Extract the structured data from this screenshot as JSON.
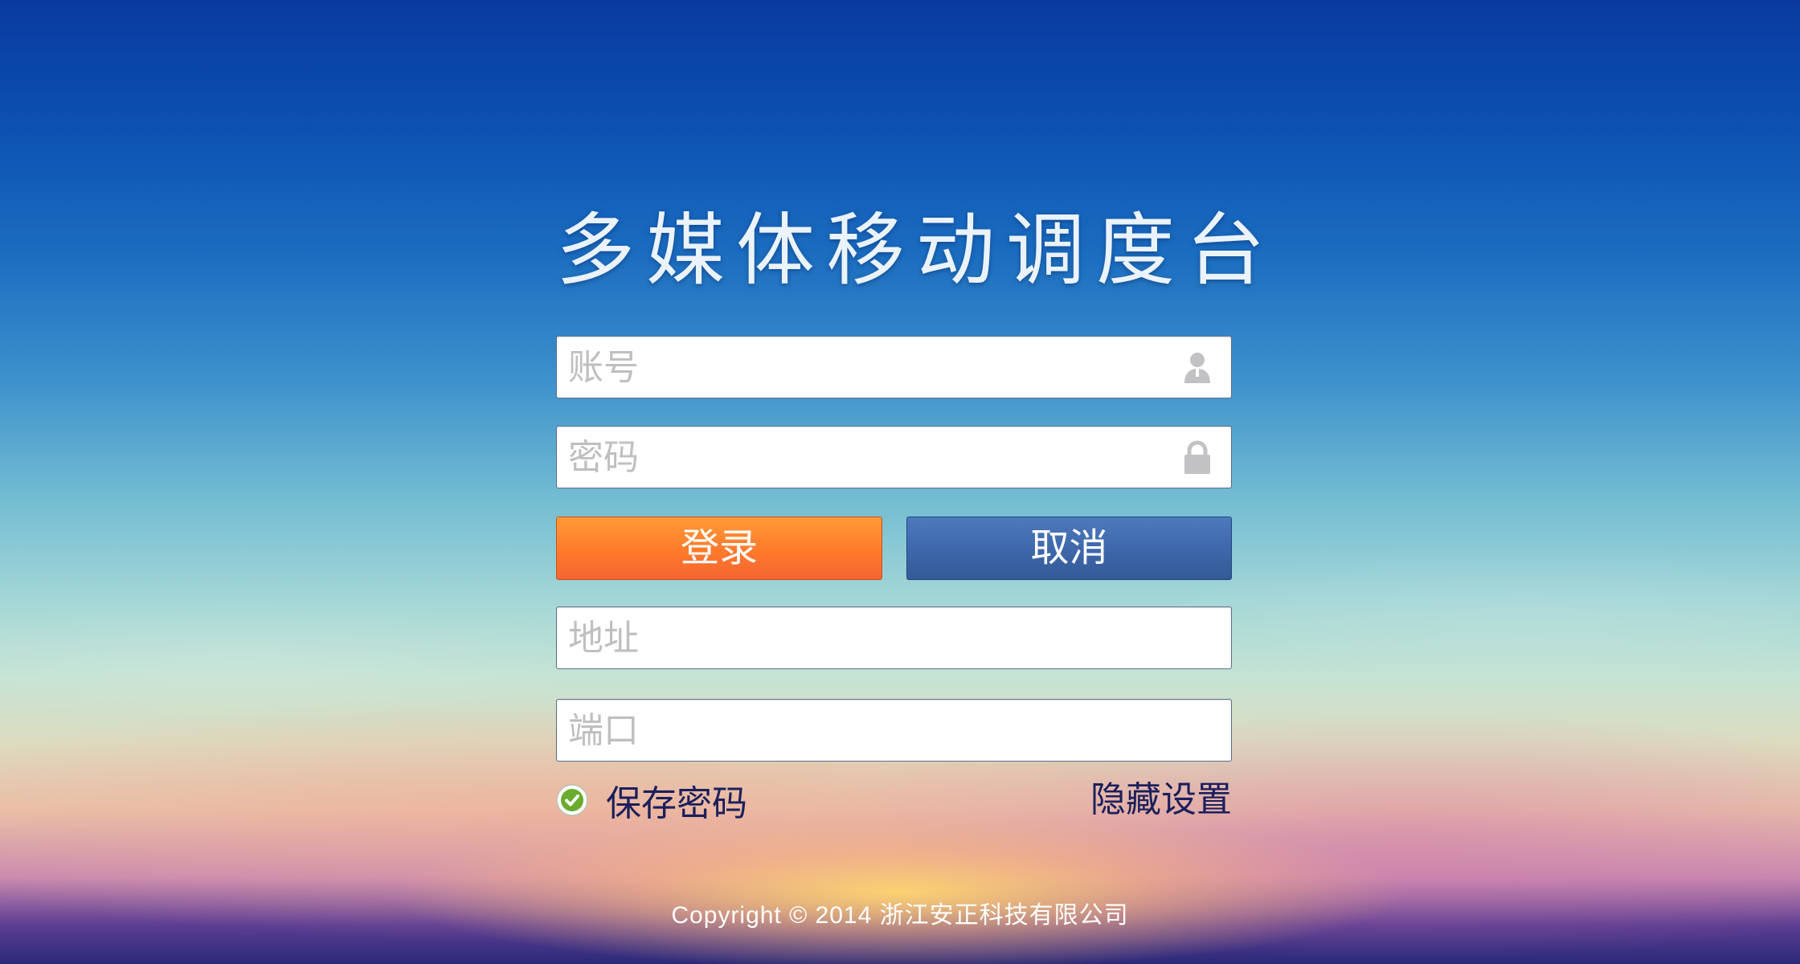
{
  "app": {
    "title": "多媒体移动调度台"
  },
  "form": {
    "account": {
      "placeholder": "账号",
      "value": "",
      "icon": "user-icon"
    },
    "password": {
      "placeholder": "密码",
      "value": "",
      "icon": "lock-icon"
    },
    "address": {
      "placeholder": "地址",
      "value": ""
    },
    "port": {
      "placeholder": "端口",
      "value": ""
    }
  },
  "buttons": {
    "login_label": "登录",
    "cancel_label": "取消"
  },
  "options": {
    "remember_label": "保存密码",
    "remember_checked": true,
    "hide_settings_label": "隐藏设置"
  },
  "footer": {
    "copyright": "Copyright © 2014 浙江安正科技有限公司"
  },
  "colors": {
    "login_button": "#ff7a2c",
    "cancel_button": "#3d67aa",
    "check_green": "#6aab2e",
    "link_text": "#1b1f5c"
  }
}
